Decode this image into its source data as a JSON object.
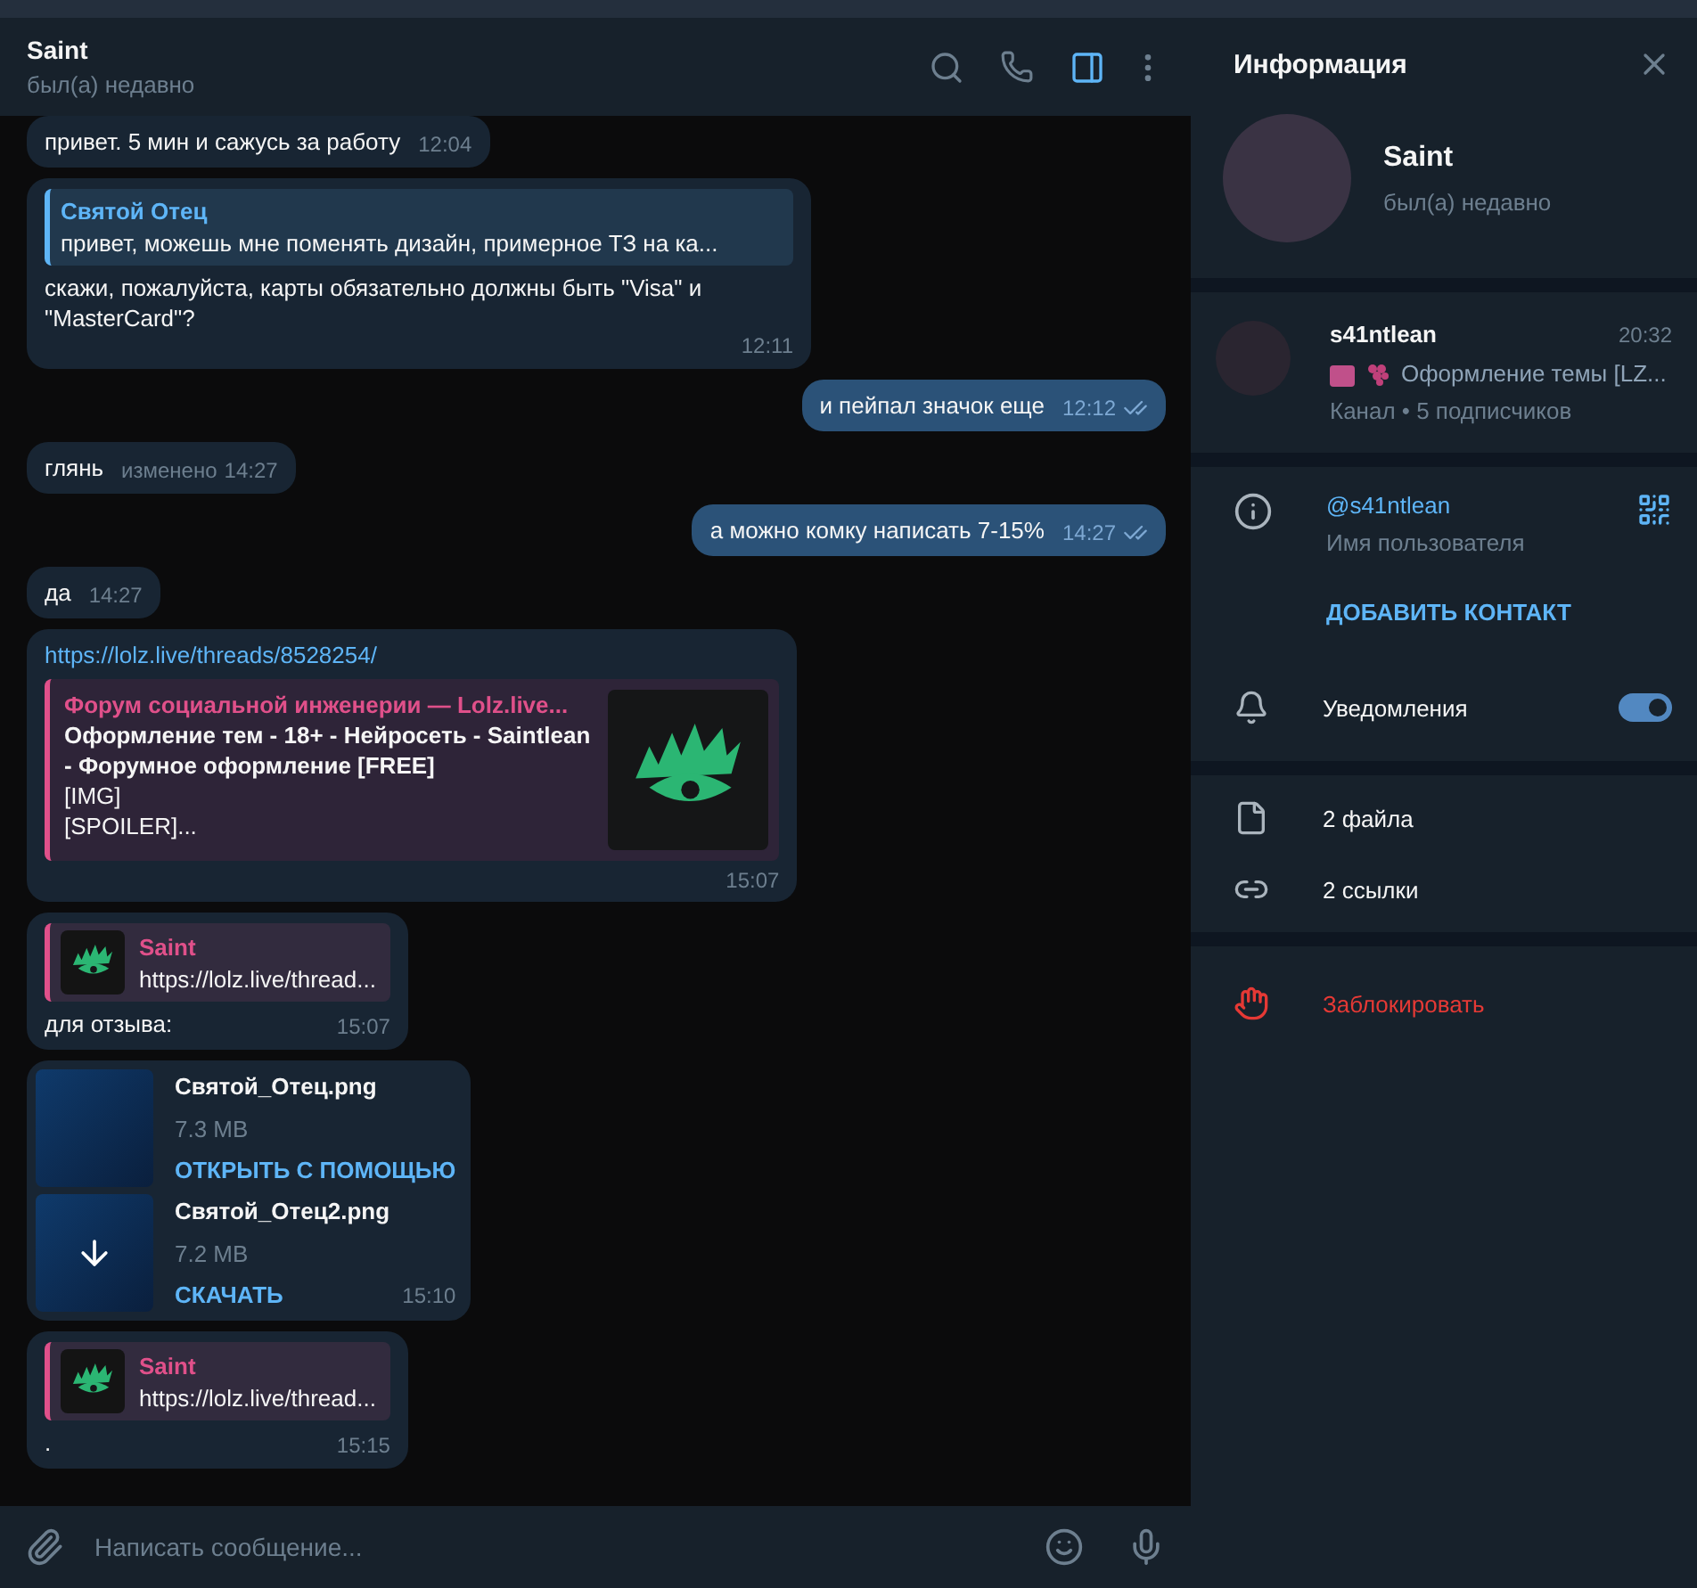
{
  "chat_header": {
    "title": "Saint",
    "status": "был(а) недавно",
    "info_panel_open": true
  },
  "messages": [
    {
      "kind": "text",
      "outgoing": false,
      "text": "привет. 5 мин и сажусь за работу",
      "time": "12:04"
    },
    {
      "kind": "text",
      "outgoing": false,
      "reply": {
        "author": "Святой Отец",
        "text": "привет, можешь мне поменять дизайн, примерное ТЗ на ка...",
        "color": "#5eb5f7",
        "thumb": false
      },
      "text": "скажи, пожалуйста, карты обязательно должны быть \"Visa\" и \"MasterCard\"?",
      "time": "12:11"
    },
    {
      "kind": "text",
      "outgoing": true,
      "text": "и пейпал значок еще",
      "time": "12:12",
      "read": true
    },
    {
      "kind": "text",
      "outgoing": false,
      "text": "глянь",
      "edited": "изменено",
      "time": "14:27"
    },
    {
      "kind": "text",
      "outgoing": true,
      "text": "а можно комку написать 7-15%",
      "time": "14:27",
      "read": true
    },
    {
      "kind": "text",
      "outgoing": false,
      "text": "да",
      "time": "14:27"
    },
    {
      "kind": "link",
      "outgoing": false,
      "url": "https://lolz.live/threads/8528254/",
      "preview": {
        "site": "Форум социальной инженерии —  Lolz.live...",
        "lines": [
          "Оформление тем - 18+ - Нейросеть - Saintlean",
          "- Форумное оформление [FREE]",
          "[IMG]",
          "[SPOILER]..."
        ]
      },
      "time": "15:07"
    },
    {
      "kind": "text",
      "outgoing": false,
      "reply": {
        "author": "Saint",
        "text": "https://lolz.live/thread...",
        "color": "#e0508a",
        "thumb": true
      },
      "text": "для отзыва:",
      "time": "15:07"
    },
    {
      "kind": "files",
      "outgoing": false,
      "files": [
        {
          "name": "Святой_Отец.png",
          "size": "7.3 MB",
          "action": "ОТКРЫТЬ С ПОМОЩЬЮ",
          "downloaded": true
        },
        {
          "name": "Святой_Отец2.png",
          "size": "7.2 MB",
          "action": "СКАЧАТЬ",
          "downloaded": false
        }
      ],
      "time": "15:10"
    },
    {
      "kind": "text",
      "outgoing": false,
      "reply": {
        "author": "Saint",
        "text": "https://lolz.live/thread...",
        "color": "#e0508a",
        "thumb": true
      },
      "text": ".",
      "time": "15:15"
    }
  ],
  "composer": {
    "placeholder": "Написать сообщение..."
  },
  "info_panel": {
    "title": "Информация",
    "name": "Saint",
    "status": "был(а) недавно",
    "channel": {
      "name": "s41ntlean",
      "time": "20:32",
      "preview": "Оформление темы [LZ...",
      "meta": "Канал • 5 подписчиков"
    },
    "username": {
      "value": "@s41ntlean",
      "label": "Имя пользователя"
    },
    "add_contact": "ДОБАВИТЬ КОНТАКТ",
    "notifications": {
      "label": "Уведомления",
      "on": true
    },
    "media": [
      {
        "kind": "files",
        "label": "2 файла"
      },
      {
        "kind": "links",
        "label": "2 ссылки"
      }
    ],
    "block": "Заблокировать"
  }
}
